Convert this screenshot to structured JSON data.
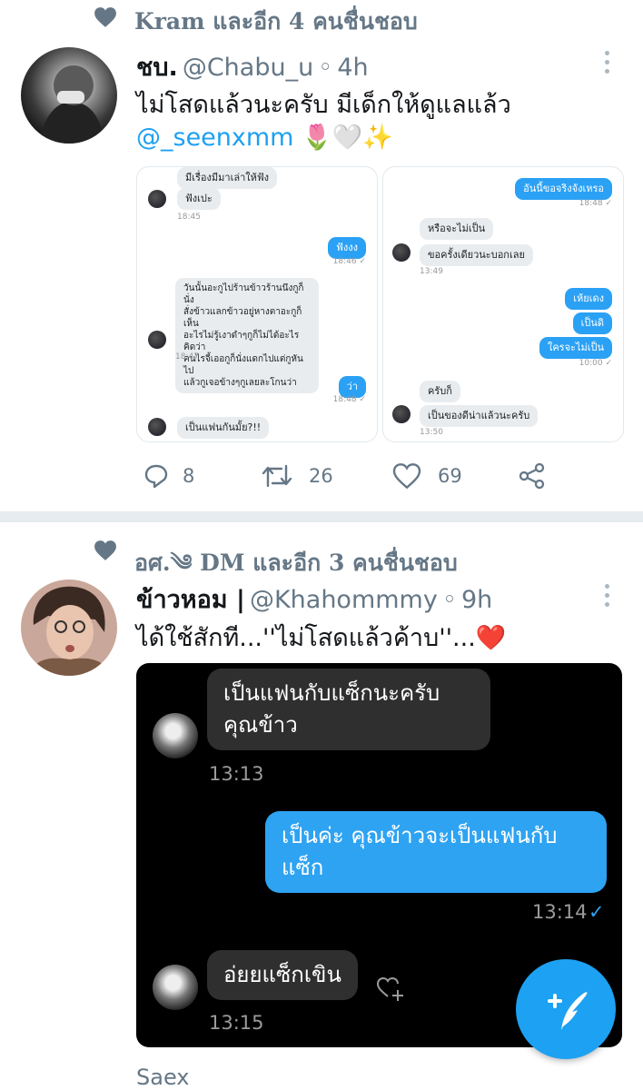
{
  "tweet1": {
    "liked_by": "Kram และอีก 4 คนชื่นชอบ",
    "display_name": "ชบ.",
    "handle": "@Chabu_u",
    "separator": "◦",
    "time": "4h",
    "text_line1": "ไม่โสดแล้วนะครับ มีเด็กให้ดูแลแล้ว",
    "mention": "@_seenxmm",
    "emojis": "🌷🤍✨",
    "chat_left": [
      {
        "text": "มีเรื่องมีมาเล่าให้ฟัง",
        "dir": "in"
      },
      {
        "text": "ฟังเปะ",
        "dir": "in"
      },
      {
        "time": "18:45"
      },
      {
        "text": "ฟังงง",
        "dir": "out"
      },
      {
        "time": "18:46 ✓"
      },
      {
        "text": "วันนั้นอะกูไปร้านข้าวร้านนึงกูก็นั่ง\nสั่งข้าวแลกข้าวอยู่หางตาอะกูก็เห็น\nอะไรไม่รู้เงาดำๆกูก็ไม่ได้อะไรคิดว่า\nคนไรจี้เออกูก็นั่งแดกไปแต่กูหันไป\nแล้วกูเจอข้างๆกูเลยละโกนว่า",
        "dir": "in"
      },
      {
        "time": "18:47"
      },
      {
        "text": "ว่า",
        "dir": "out"
      },
      {
        "time": "18:48 ✓"
      },
      {
        "text": "เป็นแฟนกันมั้ย?!!",
        "dir": "in"
      }
    ],
    "chat_right": [
      {
        "text": "อันนี้ขอจริงจังเหรอ",
        "dir": "out"
      },
      {
        "time": "18:48 ✓"
      },
      {
        "text": "หรือจะไม่เป็น",
        "dir": "in"
      },
      {
        "text": "ขอครั้งเดียวนะบอกเลย",
        "dir": "in"
      },
      {
        "time": "13:49"
      },
      {
        "text": "เห้ยเดง",
        "dir": "out"
      },
      {
        "text": "เป็นดิ",
        "dir": "out"
      },
      {
        "text": "ใครจะไม่เป็น",
        "dir": "out"
      },
      {
        "time": "10:00 ✓"
      },
      {
        "text": "ครับก็",
        "dir": "in"
      },
      {
        "text": "เป็นของดีน่าแล้วนะครับ",
        "dir": "in"
      },
      {
        "time": "13:50"
      }
    ],
    "replies": "8",
    "retweets": "26",
    "likes": "69"
  },
  "tweet2": {
    "liked_by": "อศ.༄ DM และอีก 3 คนชื่นชอบ",
    "display_name": "ข้าวหอม |",
    "handle": "@Khahommmy",
    "separator": "◦",
    "time": "9h",
    "text": "ได้ใช้สักที...''ไม่โสดแล้วค้าบ''...❤️",
    "chat": {
      "msg1": "เป็นแฟนกับแซ็กนะครับ\nคุณข้าว",
      "time1": "13:13",
      "msg2": "เป็นค่ะ คุณข้าวจะเป็นแฟนกับ\nแซ็ก",
      "time2": "13:14",
      "check": "✓",
      "msg3": "อ่ยยแซ็กเขิน",
      "time3": "13:15"
    }
  },
  "watermark": "Saex",
  "colors": {
    "accent": "#1da1f2",
    "muted": "#657786",
    "heart": "#e0245e"
  },
  "icons": [
    "heart-icon",
    "more-icon",
    "reply-icon",
    "retweet-icon",
    "like-icon",
    "share-icon",
    "compose-icon",
    "react-icon"
  ]
}
